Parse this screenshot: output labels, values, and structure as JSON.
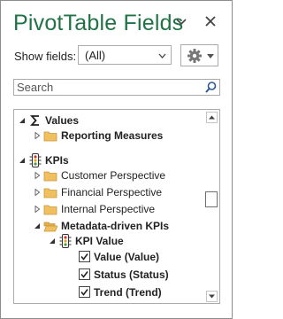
{
  "header": {
    "title": "PivotTable Fields",
    "options_icon": "chevron-down-icon",
    "close_icon": "close-icon"
  },
  "show_fields": {
    "label": "Show fields:",
    "value": "(All)",
    "tools_icon": "gear-icon"
  },
  "search": {
    "placeholder": "Search",
    "icon": "search-icon"
  },
  "tree": {
    "items": [
      {
        "label": "Values",
        "bold": true,
        "expanded": true,
        "icon": "sigma-icon"
      },
      {
        "label": "Reporting Measures",
        "bold": true,
        "expanded": false,
        "icon": "folder-icon"
      },
      {
        "label": "KPIs",
        "bold": true,
        "expanded": true,
        "icon": "traffic-light-icon"
      },
      {
        "label": "Customer Perspective",
        "bold": false,
        "expanded": false,
        "icon": "folder-icon"
      },
      {
        "label": "Financial Perspective",
        "bold": false,
        "expanded": false,
        "icon": "folder-icon"
      },
      {
        "label": "Internal Perspective",
        "bold": false,
        "expanded": false,
        "icon": "folder-icon"
      },
      {
        "label": "Metadata-driven KPIs",
        "bold": true,
        "expanded": true,
        "icon": "folder-open-icon"
      },
      {
        "label": "KPI Value",
        "bold": true,
        "expanded": true,
        "icon": "traffic-light-icon"
      },
      {
        "label": "Value (Value)",
        "bold": true,
        "checked": true
      },
      {
        "label": "Status (Status)",
        "bold": true,
        "checked": true
      },
      {
        "label": "Trend (Trend)",
        "bold": true,
        "checked": true
      }
    ]
  },
  "colors": {
    "title_green": "#217346",
    "folder_yellow": "#f0c060",
    "traffic_green": "#4c9a3c",
    "traffic_amber": "#e6a817",
    "traffic_red": "#d13438"
  }
}
